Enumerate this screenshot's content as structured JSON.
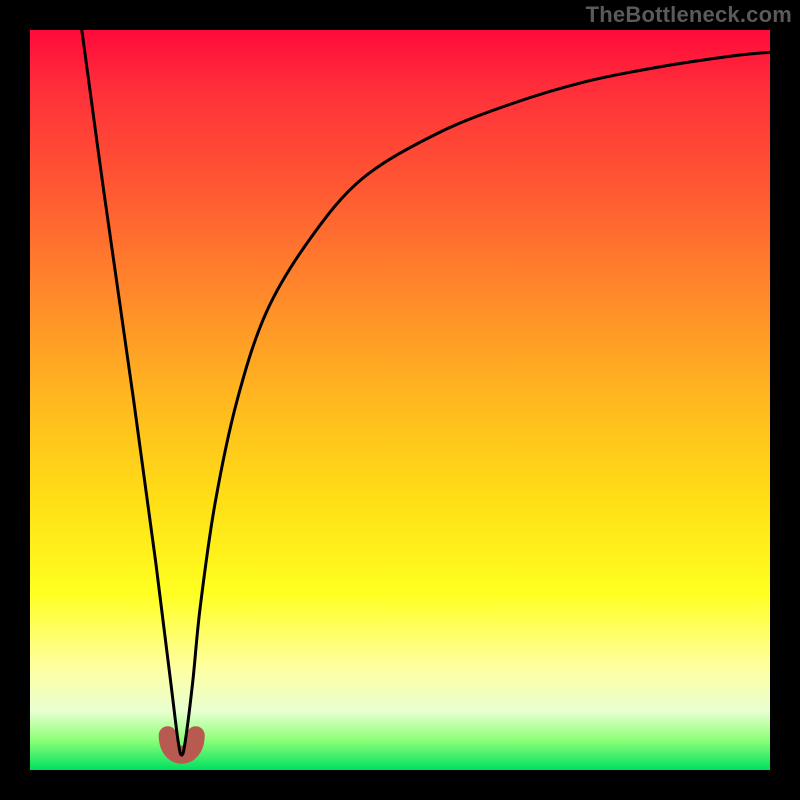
{
  "watermark": "TheBottleneck.com",
  "chart_data": {
    "type": "line",
    "title": "",
    "xlabel": "",
    "ylabel": "",
    "xlim": [
      0,
      100
    ],
    "ylim": [
      0,
      100
    ],
    "series": [
      {
        "name": "bottleneck-curve",
        "x": [
          7,
          10,
          14,
          17,
          19,
          20,
          20.5,
          21,
          22,
          23,
          25,
          28,
          32,
          38,
          45,
          55,
          65,
          75,
          85,
          95,
          100
        ],
        "values": [
          100,
          78,
          50,
          28,
          12,
          4,
          2,
          4,
          12,
          22,
          36,
          50,
          62,
          72,
          80,
          86,
          90,
          93,
          95,
          96.5,
          97
        ]
      }
    ],
    "annotations": [
      {
        "name": "min-foot",
        "x": 20.5,
        "y": 2
      }
    ]
  }
}
